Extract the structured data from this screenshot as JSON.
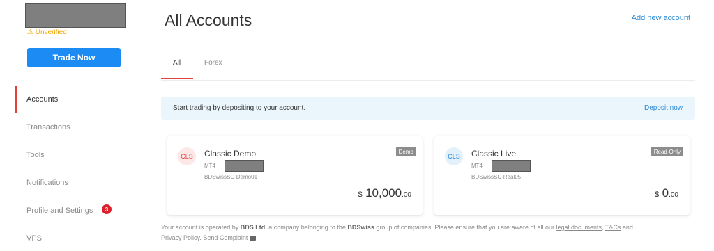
{
  "sidebar": {
    "status": "⚠ Unverified",
    "trade_button": "Trade Now",
    "items": [
      {
        "label": "Accounts"
      },
      {
        "label": "Transactions"
      },
      {
        "label": "Tools"
      },
      {
        "label": "Notifications"
      },
      {
        "label": "Profile and Settings",
        "badge": "3"
      },
      {
        "label": "VPS"
      }
    ]
  },
  "header": {
    "title": "All Accounts",
    "add_account": "Add new account"
  },
  "tabs": [
    {
      "label": "All",
      "active": true
    },
    {
      "label": "Forex",
      "active": false
    }
  ],
  "banner": {
    "text": "Start trading by depositing to your account.",
    "action": "Deposit now"
  },
  "accounts": [
    {
      "icon": "CLS",
      "icon_color": "#e0413f",
      "icon_bg": "#fde8e8",
      "name": "Classic Demo",
      "platform": "MT4",
      "server": "BDSwissSC-Demo01",
      "tag": "Demo",
      "currency": "$",
      "balance_int": "10,000",
      "balance_dec": ".00"
    },
    {
      "icon": "CLS",
      "icon_color": "#2a8ad6",
      "icon_bg": "#e3f1fb",
      "name": "Classic Live",
      "platform": "MT4",
      "server": "BDSwissSC-Real05",
      "tag": "Read-Only",
      "currency": "$",
      "balance_int": "0",
      "balance_dec": ".00"
    }
  ],
  "footer": {
    "p1": "Your account is operated by ",
    "company": "BDS Ltd",
    "p2": ", a company belonging to the ",
    "group": "BDSwiss",
    "p3": " group of companies. Please ensure that you are aware of all our ",
    "legal": "legal documents",
    "sep1": ", ",
    "tcs": "T&Cs",
    "sep2": " and",
    "privacy": "Privacy Policy",
    "sep3": ". ",
    "complaint": "Send Complaint"
  }
}
